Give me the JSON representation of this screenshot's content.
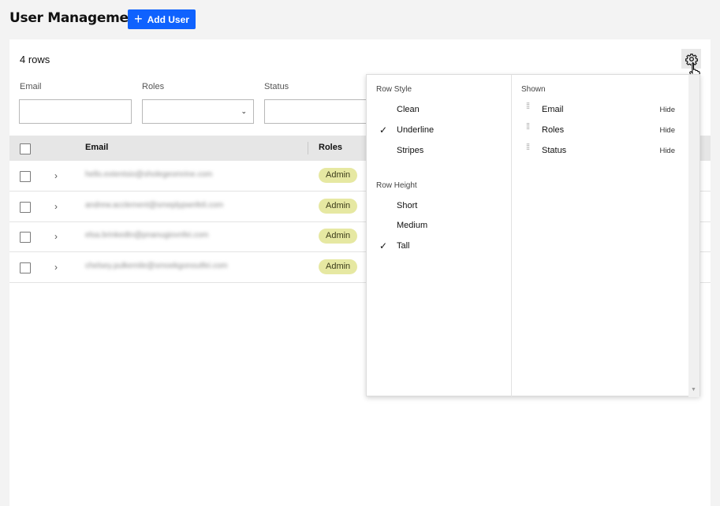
{
  "header": {
    "title": "User Management",
    "add_button_label": "Add User"
  },
  "table": {
    "row_count": "4 rows",
    "filters": {
      "email_label": "Email",
      "roles_label": "Roles",
      "status_label": "Status",
      "select_chevron": "⌄"
    },
    "columns": {
      "email": "Email",
      "roles": "Roles"
    },
    "rows": [
      {
        "email": "hello.extentsio@sholegeomrine.com",
        "role": "Admin"
      },
      {
        "email": "andrew.acclement@smeplypwnfeli.com",
        "role": "Admin"
      },
      {
        "email": "elsa.brinkedtn@pnanugiovnfei.com",
        "role": "Admin"
      },
      {
        "email": "chelsey.pulkemile@smoekgonoutfei.com",
        "role": "Admin"
      }
    ]
  },
  "settings_panel": {
    "row_style": {
      "heading": "Row Style",
      "options": [
        "Clean",
        "Underline",
        "Stripes"
      ],
      "selected": "Underline"
    },
    "row_height": {
      "heading": "Row Height",
      "options": [
        "Short",
        "Medium",
        "Tall"
      ],
      "selected": "Tall"
    },
    "shown": {
      "heading": "Shown",
      "columns": [
        {
          "name": "Email",
          "action": "Hide"
        },
        {
          "name": "Roles",
          "action": "Hide"
        },
        {
          "name": "Status",
          "action": "Hide"
        }
      ]
    },
    "checkmark": "✓"
  },
  "colors": {
    "primary": "#0f62fe",
    "badge_bg": "#e6e8a2",
    "header_bg": "#e6e6e6"
  }
}
